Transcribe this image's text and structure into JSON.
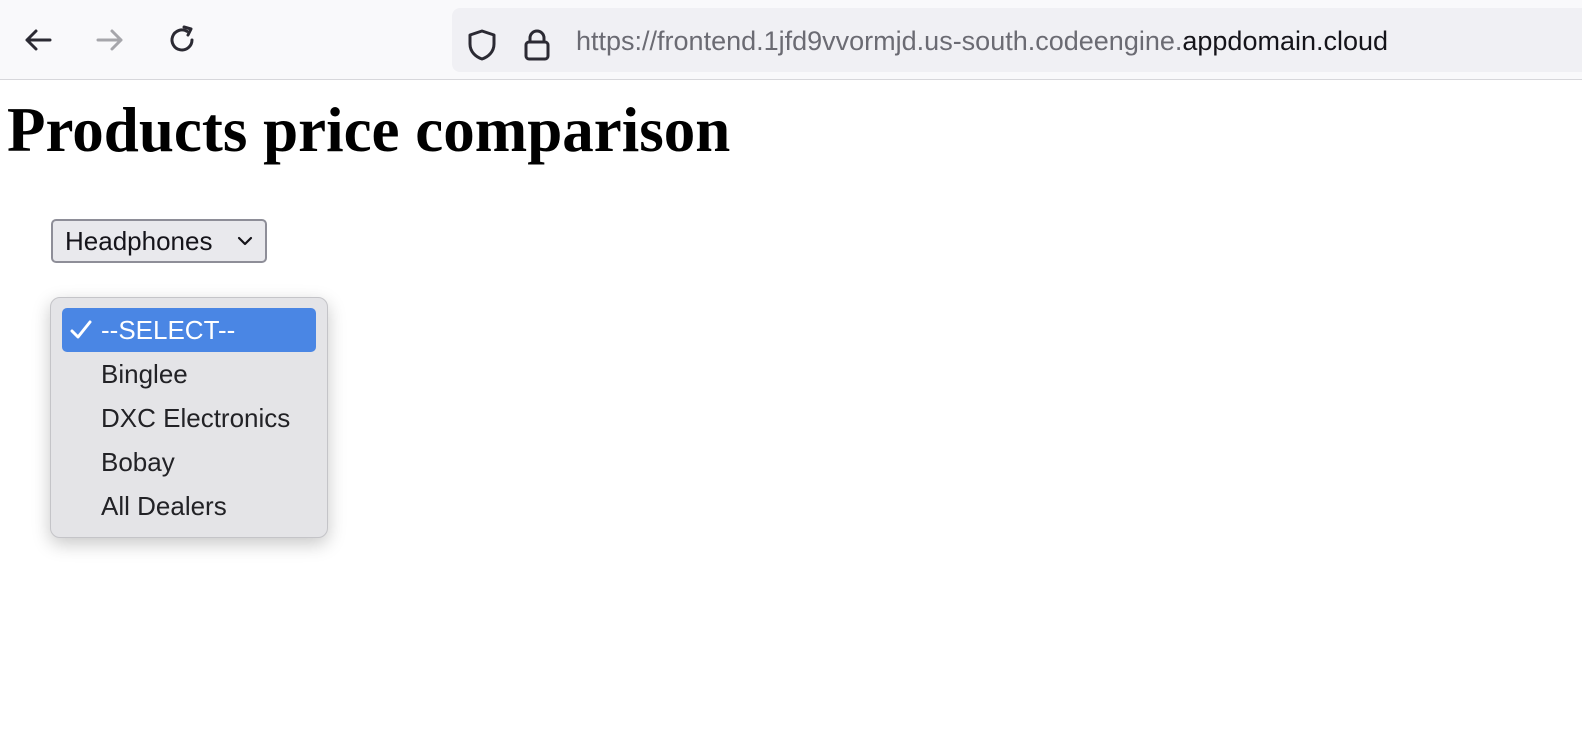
{
  "browser": {
    "url_prefix": "https://frontend.1jfd9vvormjd.us-south.codeengine.",
    "url_domain": "appdomain.cloud",
    "icons": [
      "back-arrow-icon",
      "forward-arrow-icon",
      "reload-icon",
      "shield-icon",
      "lock-icon"
    ]
  },
  "page": {
    "title": "Products price comparison"
  },
  "product_select": {
    "value": "Headphones",
    "icon": "chevron-down-icon"
  },
  "dealer_dropdown": {
    "options": [
      {
        "label": "--SELECT--",
        "selected": true
      },
      {
        "label": "Binglee",
        "selected": false
      },
      {
        "label": "DXC Electronics",
        "selected": false
      },
      {
        "label": "Bobay",
        "selected": false
      },
      {
        "label": "All Dealers",
        "selected": false
      }
    ],
    "selected_color": "#4a86e4",
    "check_icon": "checkmark-icon"
  }
}
